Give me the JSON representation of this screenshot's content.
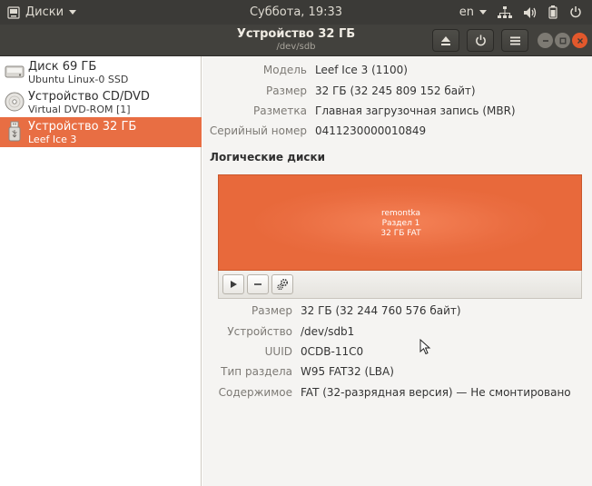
{
  "top_panel": {
    "app_name": "Диски",
    "clock": "Суббота, 19:33",
    "language": "en"
  },
  "header": {
    "title": "Устройство 32 ГБ",
    "subtitle": "/dev/sdb"
  },
  "devices": [
    {
      "name": "Диск 69 ГБ",
      "sub": "Ubuntu Linux-0 SSD",
      "icon": "hard-disk-icon",
      "selected": false
    },
    {
      "name": "Устройство CD/DVD",
      "sub": "Virtual DVD-ROM [1]",
      "icon": "optical-disc-icon",
      "selected": false
    },
    {
      "name": "Устройство 32 ГБ",
      "sub": "Leef Ice 3",
      "icon": "usb-drive-icon",
      "selected": true
    }
  ],
  "drive_props": [
    {
      "label": "Модель",
      "value": "Leef Ice 3 (1100)"
    },
    {
      "label": "Размер",
      "value": "32 ГБ (32 245 809 152 байт)"
    },
    {
      "label": "Разметка",
      "value": "Главная загрузочная запись (MBR)"
    },
    {
      "label": "Серийный номер",
      "value": "0411230000010849"
    }
  ],
  "volumes_title": "Логические диски",
  "volume": {
    "line1": "remontka",
    "line2": "Раздел 1",
    "line3": "32 ГБ FAT"
  },
  "volume_props": [
    {
      "label": "Размер",
      "value": "32 ГБ (32 244 760 576 байт)"
    },
    {
      "label": "Устройство",
      "value": "/dev/sdb1"
    },
    {
      "label": "UUID",
      "value": "0CDB-11C0"
    },
    {
      "label": "Тип раздела",
      "value": "W95 FAT32 (LBA)"
    },
    {
      "label": "Содержимое",
      "value": "FAT (32-разрядная версия) — Не смонтировано"
    }
  ],
  "colors": {
    "accent": "#e86e43",
    "panel": "#3b3a37",
    "headerbar": "#42413d"
  }
}
